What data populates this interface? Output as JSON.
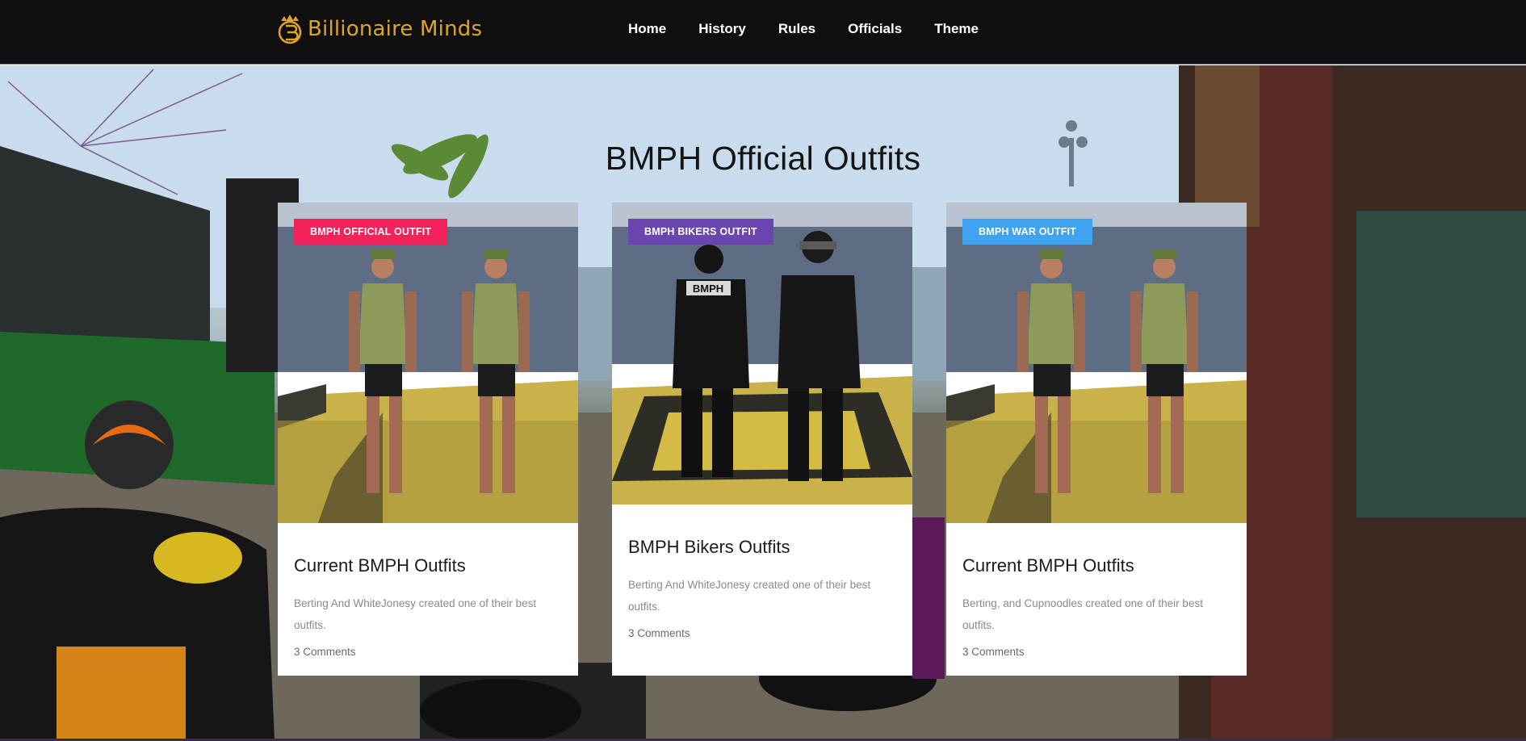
{
  "header": {
    "brand_name": "Billionaire Minds",
    "brand_color": "#e0a526",
    "nav": [
      {
        "label": "Home"
      },
      {
        "label": "History"
      },
      {
        "label": "Rules"
      },
      {
        "label": "Officials"
      },
      {
        "label": "Theme"
      }
    ]
  },
  "section": {
    "title": "BMPH Official Outfits"
  },
  "cards": [
    {
      "badge": "BMPH OFFICIAL OUTFIT",
      "badge_color": "#f5215b",
      "title": "Current BMPH Outfits",
      "excerpt": "Berting And WhiteJonesy created one of their best outfits.",
      "comments": "3 Comments"
    },
    {
      "badge": "BMPH BIKERS OUTFIT",
      "badge_color": "#6b46b0",
      "title": "BMPH Bikers Outfits",
      "excerpt": "Berting And WhiteJonesy created one of their best outfits.",
      "comments": "3 Comments",
      "image_text": "BMPH"
    },
    {
      "badge": "BMPH WAR OUTFIT",
      "badge_color": "#3fa3f0",
      "title": "Current BMPH Outfits",
      "excerpt": "Berting, and Cupnoodles created one of their best outfits.",
      "comments": "3 Comments"
    }
  ]
}
